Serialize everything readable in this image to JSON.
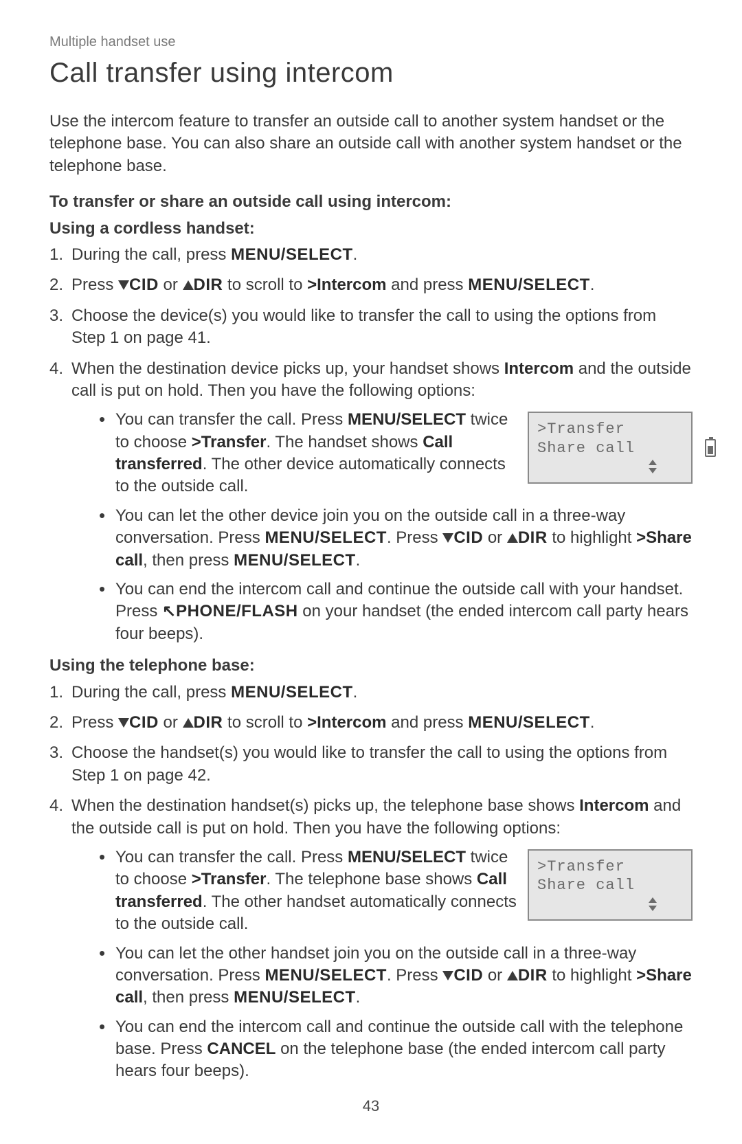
{
  "section_label": "Multiple handset use",
  "title": "Call transfer using intercom",
  "intro": "Use the intercom feature to transfer an outside call to another system handset or the telephone base. You can also share an outside call with another system handset or the telephone base.",
  "h_transfer": "To transfer or share an outside call using intercom:",
  "h_cordless": "Using a cordless handset:",
  "kw": {
    "menu_select_sc": "MENU/SELECT",
    "menu_select_upper": "MENU/SELECT",
    "cid": "CID",
    "dir": "DIR",
    "intercom_menu": ">Intercom",
    "intercom_word": "Intercom",
    "transfer_menu": ">Transfer",
    "call_transferred": "Call transferred",
    "share_call_menu": ">Share call",
    "phone_flash": "PHONE/FLASH",
    "cancel": "CANCEL"
  },
  "cordless": {
    "s1a": "During the call, press ",
    "s1b": ".",
    "s2a": "Press ",
    "s2b": " or ",
    "s2c": " to scroll to ",
    "s2d": " and press ",
    "s2e": ".",
    "s3": "Choose the device(s) you would like to transfer the call to using the options from Step 1 on page 41.",
    "s4a": "When the destination device picks up, your handset shows ",
    "s4b": " and the outside call is put on hold. Then you have the following options:",
    "b1a": "You can transfer the call. Press ",
    "b1b": " twice to choose ",
    "b1c": ". The handset shows ",
    "b1d": ". The other device automatically connects to the outside call.",
    "b2a": "You can let the other device join you on the outside call in a three-way conversation. Press ",
    "b2b": ". Press ",
    "b2c": " or ",
    "b2d": " to highlight ",
    "b2e": ", then press ",
    "b2f": ".",
    "b3a": "You can end the intercom call and continue the outside call with your handset. Press ",
    "b3b": " on your handset (the ended intercom call party hears four beeps)."
  },
  "h_base": "Using the telephone base:",
  "base": {
    "s1a": "During the call, press ",
    "s1b": ".",
    "s2a": "Press ",
    "s2b": " or ",
    "s2c": " to scroll to ",
    "s2d": " and press ",
    "s2e": ".",
    "s3": "Choose the handset(s) you would like to transfer the call to using the options from Step 1 on page 42.",
    "s4a": "When the destination handset(s) picks up, the telephone base shows ",
    "s4b": " and the outside call is put on hold. Then you have the following options:",
    "b1a": "You can transfer the call. Press ",
    "b1b": " twice to choose ",
    "b1c": ". The telephone base shows ",
    "b1d": ". The other handset automatically connects to the outside call.",
    "b2a": "You can let the other handset join you on the outside call in a three-way conversation. Press ",
    "b2b": ". Press ",
    "b2c": " or ",
    "b2d": " to highlight ",
    "b2e": ", then press ",
    "b2f": ".",
    "b3a": "You can end the intercom call and continue the outside call with the telephone base. Press ",
    "b3b": " on the telephone base (the ended intercom call party hears four beeps)."
  },
  "lcd": {
    "line1": ">Transfer",
    "line2": " Share call"
  },
  "page_number": "43"
}
